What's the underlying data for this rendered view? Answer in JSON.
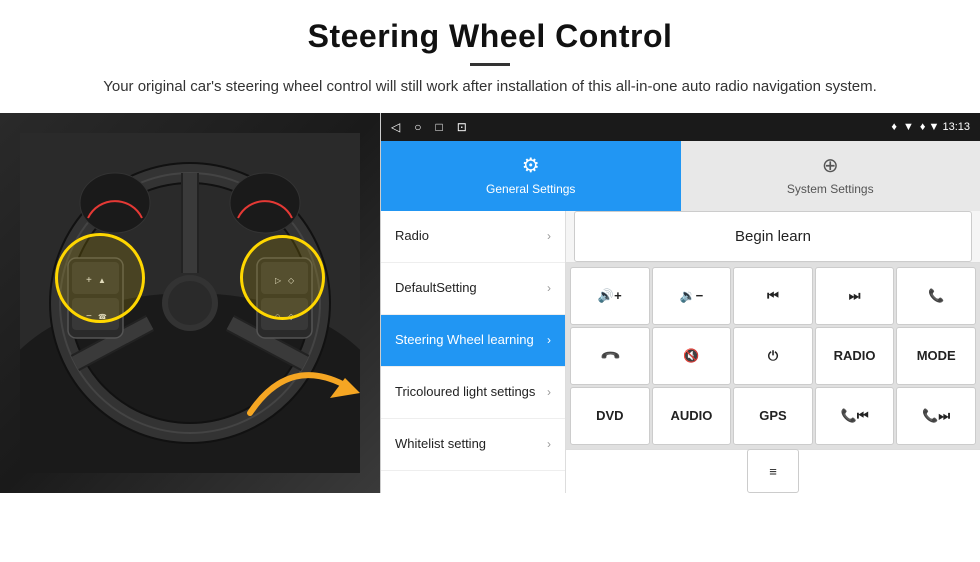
{
  "header": {
    "title": "Steering Wheel Control",
    "subtitle": "Your original car's steering wheel control will still work after installation of this all-in-one auto radio navigation system."
  },
  "statusBar": {
    "navIcons": [
      "◁",
      "○",
      "□",
      "⊡"
    ],
    "rightIcons": "♦ ▼ 13:13"
  },
  "tabs": [
    {
      "id": "general",
      "label": "General Settings",
      "icon": "⚙",
      "active": true
    },
    {
      "id": "system",
      "label": "System Settings",
      "icon": "⊕",
      "active": false
    }
  ],
  "menuItems": [
    {
      "id": "radio",
      "label": "Radio",
      "active": false
    },
    {
      "id": "default",
      "label": "DefaultSetting",
      "active": false
    },
    {
      "id": "steering",
      "label": "Steering Wheel learning",
      "active": true
    },
    {
      "id": "tricolour",
      "label": "Tricoloured light settings",
      "active": false
    },
    {
      "id": "whitelist",
      "label": "Whitelist setting",
      "active": false
    }
  ],
  "controls": {
    "beginLearnLabel": "Begin learn",
    "buttons": [
      {
        "id": "vol-up",
        "label": "◀+",
        "type": "icon"
      },
      {
        "id": "vol-down",
        "label": "◀−",
        "type": "icon"
      },
      {
        "id": "prev-track",
        "label": "⏮",
        "type": "icon"
      },
      {
        "id": "next-track",
        "label": "⏭",
        "type": "icon"
      },
      {
        "id": "phone",
        "label": "✆",
        "type": "icon"
      },
      {
        "id": "hang-up",
        "label": "↩",
        "type": "icon"
      },
      {
        "id": "mute",
        "label": "◀×",
        "type": "icon"
      },
      {
        "id": "power",
        "label": "⏻",
        "type": "icon"
      },
      {
        "id": "radio-btn",
        "label": "RADIO",
        "type": "text"
      },
      {
        "id": "mode-btn",
        "label": "MODE",
        "type": "text"
      },
      {
        "id": "dvd-btn",
        "label": "DVD",
        "type": "text"
      },
      {
        "id": "audio-btn",
        "label": "AUDIO",
        "type": "text"
      },
      {
        "id": "gps-btn",
        "label": "GPS",
        "type": "text"
      },
      {
        "id": "nav-prev",
        "label": "✆⏮",
        "type": "icon"
      },
      {
        "id": "nav-next",
        "label": "✆⏭",
        "type": "icon"
      }
    ],
    "bottomIcon": "≡"
  }
}
